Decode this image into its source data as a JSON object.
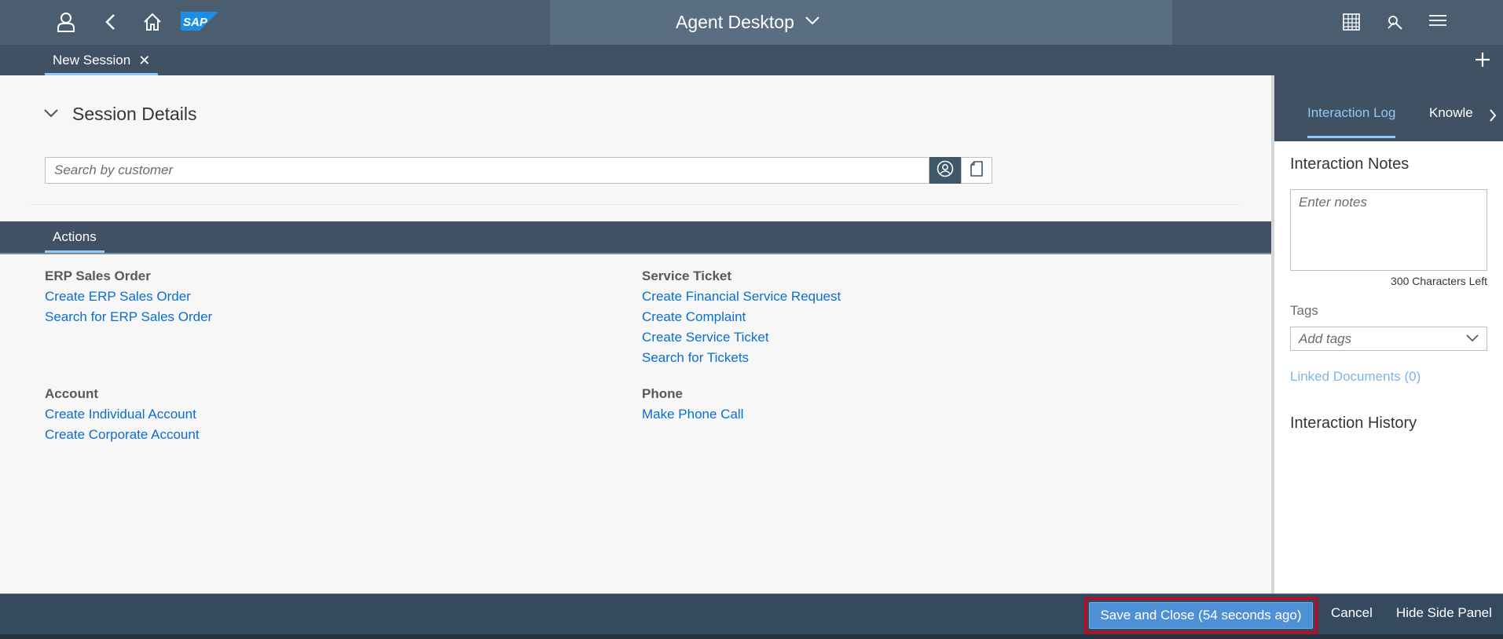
{
  "shell": {
    "logo_text": "SAP",
    "title": "Agent Desktop",
    "icons": [
      "user-icon",
      "back-icon",
      "home-icon",
      "chevron-down-icon",
      "grid-icon",
      "tools-icon",
      "notifications-icon"
    ]
  },
  "tabs": [
    {
      "label": "New Session",
      "active": true
    }
  ],
  "session": {
    "title": "Session Details",
    "search_placeholder": "Search by customer"
  },
  "actions": {
    "tab_label": "Actions",
    "groups": [
      {
        "title": "ERP Sales Order",
        "links": [
          "Create ERP Sales Order",
          "Search for ERP Sales Order"
        ]
      },
      {
        "title": "Service Ticket",
        "links": [
          "Create Financial Service Request",
          "Create Complaint",
          "Create Service Ticket",
          "Search for Tickets"
        ]
      },
      {
        "title": "Account",
        "links": [
          "Create Individual Account",
          "Create Corporate Account"
        ]
      },
      {
        "title": "Phone",
        "links": [
          "Make Phone Call"
        ]
      }
    ]
  },
  "side_panel": {
    "tabs": [
      {
        "label": "Interaction Log",
        "active": true
      },
      {
        "label": "Knowle",
        "active": false
      }
    ],
    "notes_title": "Interaction Notes",
    "notes_placeholder": "Enter notes",
    "chars_left": "300 Characters Left",
    "tags_label": "Tags",
    "tags_placeholder": "Add tags",
    "linked_documents": "Linked Documents (0)",
    "history_title": "Interaction History"
  },
  "footer": {
    "save_label": "Save and Close (54 seconds ago)",
    "cancel_label": "Cancel",
    "hide_label": "Hide Side Panel"
  },
  "colors": {
    "shell": "#4a5e70",
    "tabstrip": "#3f5162",
    "footer": "#354a5f",
    "link": "#0a6ed1",
    "accent": "#91c8f6",
    "highlight_border": "#d0021b"
  }
}
